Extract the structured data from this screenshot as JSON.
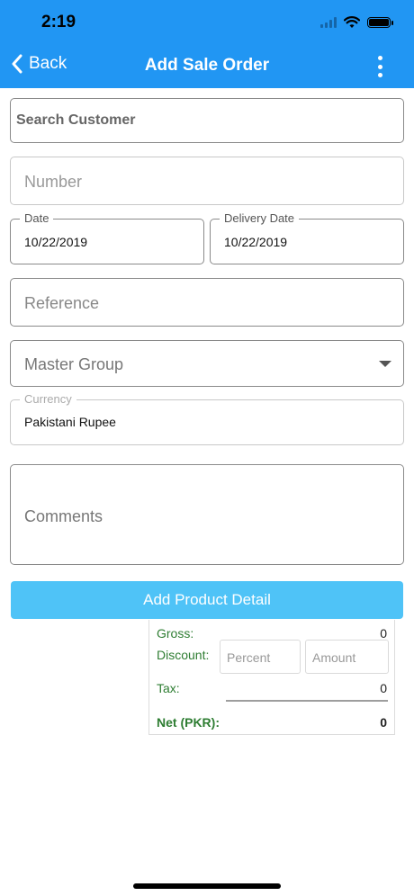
{
  "status": {
    "time": "2:19"
  },
  "nav": {
    "back_label": "Back",
    "title": "Add Sale Order"
  },
  "form": {
    "search_customer_placeholder": "Search Customer",
    "number_placeholder": "Number",
    "date_label": "Date",
    "date_value": "10/22/2019",
    "delivery_date_label": "Delivery Date",
    "delivery_date_value": "10/22/2019",
    "reference_placeholder": "Reference",
    "master_group_label": "Master Group",
    "currency_label": "Currency",
    "currency_value": "Pakistani Rupee",
    "comments_placeholder": "Comments"
  },
  "add_product_label": "Add Product Detail",
  "summary": {
    "gross_label": "Gross:",
    "gross_value": "0",
    "discount_label": "Discount:",
    "percent_placeholder": "Percent",
    "amount_placeholder": "Amount",
    "tax_label": "Tax:",
    "tax_value": "0",
    "net_label": "Net (PKR):",
    "net_value": "0"
  },
  "colors": {
    "primary": "#2196f3",
    "button": "#4fc3f7",
    "summary_label": "#2e7d32"
  }
}
